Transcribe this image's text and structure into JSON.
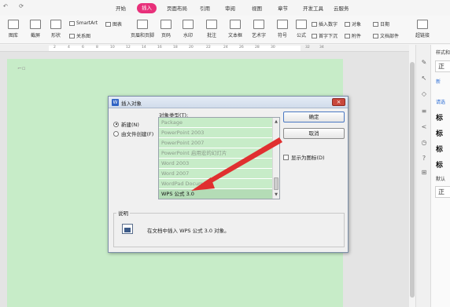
{
  "menu": {
    "quick_access": "↶ ⟳",
    "tabs": [
      "开始",
      "插入",
      "页面布局",
      "引用",
      "审阅",
      "视图",
      "章节",
      "开发工具",
      "云服务"
    ],
    "active_tab": "插入"
  },
  "ribbon": {
    "cover_page": "图库",
    "screenshot": "截屏",
    "shapes": "形状",
    "relation_graph": "关系图",
    "smartart": "SmartArt",
    "chart": "图表",
    "header_footer": "页眉和页脚",
    "page_number": "页码",
    "watermark": "水印",
    "comment": "批注",
    "textbox": "文本框",
    "wordart": "艺术字",
    "symbol": "符号",
    "formula": "公式",
    "insert_number": "插入数字",
    "object": "对象",
    "date": "日期",
    "first_letter": "首字下沉",
    "attachment": "附件",
    "doc_parts": "文档部件",
    "hyperlink": "超链接"
  },
  "ruler_ticks": [
    "2",
    "4",
    "6",
    "8",
    "10",
    "12",
    "14",
    "16",
    "18",
    "20",
    "22",
    "24",
    "26",
    "28",
    "30",
    "32",
    "34"
  ],
  "style_pane": {
    "title": "样式和",
    "normal_1": "正",
    "new_style": "新",
    "clear_link": "请选",
    "heading_1": "标",
    "heading_2": "标",
    "heading_3": "标",
    "heading_4": "标",
    "default": "默认",
    "normal_2": "正"
  },
  "dialog": {
    "title": "插入对象",
    "close_label": "×",
    "radio_new": "新建(N)",
    "radio_from_file": "由文件创建(F)",
    "type_label": "对象类型(T):",
    "object_types": [
      "Package",
      "PowerPoint 2003",
      "PowerPoint 2007",
      "PowerPoint 启用宏的幻灯片",
      "Word 2003",
      "Word 2007",
      "WordPad Document",
      "WPS 公式 3.0"
    ],
    "selected_type": "WPS 公式 3.0",
    "ok_label": "确定",
    "cancel_label": "取消",
    "display_as_icon": "显示为图标(D)",
    "description_label": "说明",
    "description_text": "在文档中插入 WPS 公式 3.0 对象。"
  },
  "colors": {
    "accent_tab": "#e8307a",
    "page_background": "#c7ecc8",
    "annotation_arrow": "#e03030"
  }
}
